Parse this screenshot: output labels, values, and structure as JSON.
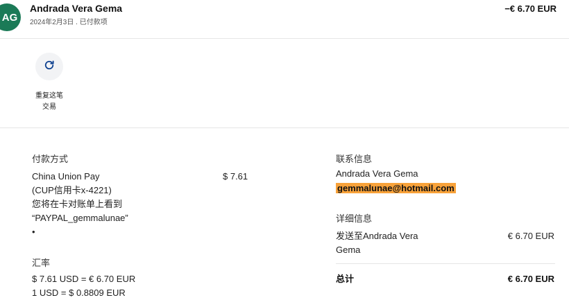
{
  "header": {
    "avatar_initials": "AG",
    "name": "Andrada Vera Gema",
    "date_status": "2024年2月3日 . 已付款项",
    "amount": "−€ 6.70 EUR"
  },
  "actions": {
    "repeat_label_line1": "重复这笔",
    "repeat_label_line2": "交易"
  },
  "payment": {
    "title": "付款方式",
    "method_line1": "China Union Pay",
    "method_line2": "(CUP信用卡x-4221)",
    "method_line3": "您将在卡对账单上看到",
    "method_line4": "“PAYPAL_gemmalunae”",
    "method_line5": "•",
    "amount": "$ 7.61"
  },
  "exchange": {
    "title": "汇率",
    "line1": "$ 7.61 USD = € 6.70 EUR",
    "line2": "1 USD = $ 0.8809 EUR"
  },
  "contact": {
    "title": "联系信息",
    "name": "Andrada Vera Gema",
    "email": "gemmalunae@hotmail.com"
  },
  "details": {
    "title": "详细信息",
    "sent_to_line1": "发送至Andrada Vera",
    "sent_to_line2": "Gema",
    "sent_amount": "€ 6.70 EUR",
    "total_label": "总计",
    "total_amount": "€ 6.70 EUR"
  },
  "colors": {
    "avatar_bg": "#1b7a57",
    "email_highlight": "#f8a23a",
    "icon_blue": "#0c3f8f"
  }
}
